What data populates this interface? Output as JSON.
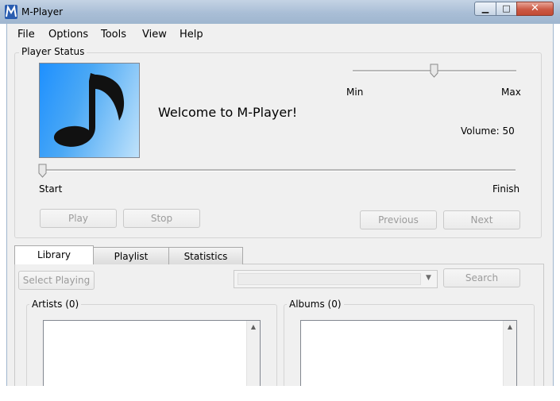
{
  "window": {
    "title": "M-Player",
    "icon_letter": "M",
    "minimize_glyph": "▁",
    "maximize_glyph": "□",
    "close_glyph": "✕"
  },
  "menu": {
    "items": [
      "File",
      "Options",
      "Tools",
      "View",
      "Help"
    ]
  },
  "player_status": {
    "legend": "Player Status",
    "welcome": "Welcome to M-Player!",
    "volume_min": "Min",
    "volume_max": "Max",
    "volume_text": "Volume: 50",
    "volume_level": 0.5,
    "seek_start": "Start",
    "seek_finish": "Finish",
    "seek_position": 0.0,
    "buttons": {
      "play": "Play",
      "stop": "Stop",
      "previous": "Previous",
      "next": "Next"
    }
  },
  "tabs": [
    "Library",
    "Playlist",
    "Statistics"
  ],
  "library": {
    "select_playing": "Select Playing",
    "search_value": "",
    "search_button": "Search",
    "artists_label": "Artists (0)",
    "albums_label": "Albums (0)"
  },
  "colors": {
    "title_bar": "#a9bed6",
    "close_button": "#cc5a45",
    "album_art": "#1e90ff"
  }
}
